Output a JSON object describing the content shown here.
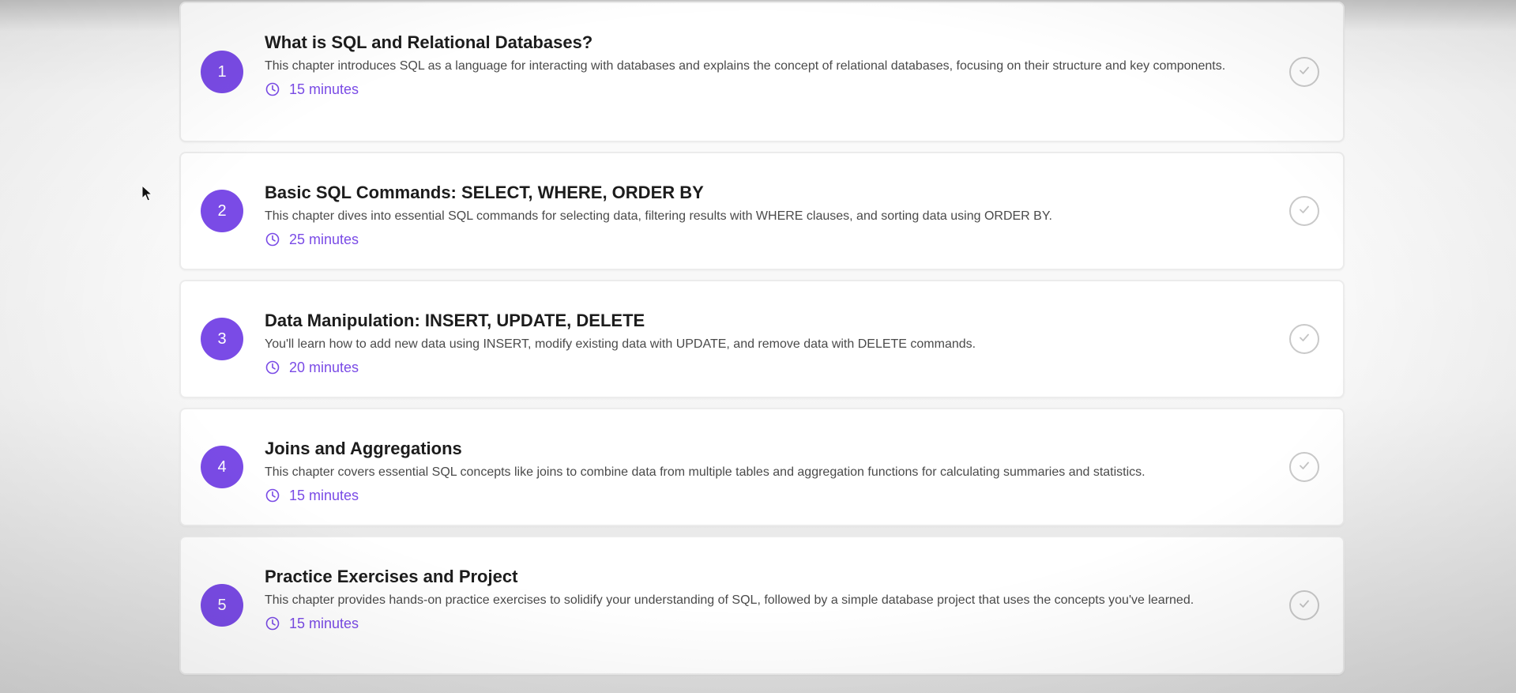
{
  "accent_color": "#7a4be6",
  "chapters": [
    {
      "number": "1",
      "title": "What is SQL and Relational Databases?",
      "description": "This chapter introduces SQL as a language for interacting with databases and explains the concept of relational databases, focusing on their structure and key components.",
      "duration": "15 minutes",
      "icons": {
        "duration": "clock-icon",
        "status": "check-circle-icon"
      }
    },
    {
      "number": "2",
      "title": "Basic SQL Commands: SELECT, WHERE, ORDER BY",
      "description": "This chapter dives into essential SQL commands for selecting data, filtering results with WHERE clauses, and sorting data using ORDER BY.",
      "duration": "25 minutes",
      "icons": {
        "duration": "clock-icon",
        "status": "check-circle-icon"
      }
    },
    {
      "number": "3",
      "title": "Data Manipulation: INSERT, UPDATE, DELETE",
      "description": "You'll learn how to add new data using INSERT, modify existing data with UPDATE, and remove data with DELETE commands.",
      "duration": "20 minutes",
      "icons": {
        "duration": "clock-icon",
        "status": "check-circle-icon"
      }
    },
    {
      "number": "4",
      "title": "Joins and Aggregations",
      "description": "This chapter covers essential SQL concepts like joins to combine data from multiple tables and aggregation functions for calculating summaries and statistics.",
      "duration": "15 minutes",
      "icons": {
        "duration": "clock-icon",
        "status": "check-circle-icon"
      }
    },
    {
      "number": "5",
      "title": "Practice Exercises and Project",
      "description": "This chapter provides hands-on practice exercises to solidify your understanding of SQL, followed by a simple database project that uses the concepts you've learned.",
      "duration": "15 minutes",
      "icons": {
        "duration": "clock-icon",
        "status": "check-circle-icon"
      }
    }
  ]
}
